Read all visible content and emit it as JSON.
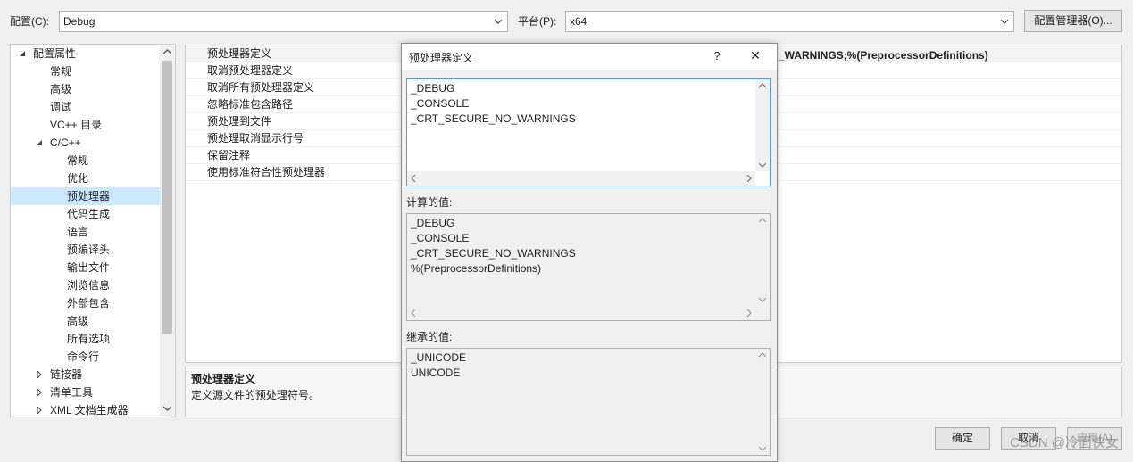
{
  "toolbar": {
    "config_label": "配置(C):",
    "config_value": "Debug",
    "platform_label": "平台(P):",
    "platform_value": "x64",
    "config_manager_button": "配置管理器(O)..."
  },
  "tree": {
    "items": [
      {
        "label": "配置属性",
        "expander": "expanded"
      },
      {
        "label": "常规"
      },
      {
        "label": "高级"
      },
      {
        "label": "调试"
      },
      {
        "label": "VC++ 目录"
      },
      {
        "label": "C/C++",
        "expander": "expanded"
      },
      {
        "label": "常规"
      },
      {
        "label": "优化"
      },
      {
        "label": "预处理器",
        "selected": true
      },
      {
        "label": "代码生成"
      },
      {
        "label": "语言"
      },
      {
        "label": "预编译头"
      },
      {
        "label": "输出文件"
      },
      {
        "label": "浏览信息"
      },
      {
        "label": "外部包含"
      },
      {
        "label": "高级"
      },
      {
        "label": "所有选项"
      },
      {
        "label": "命令行"
      },
      {
        "label": "链接器",
        "expander": "collapsed"
      },
      {
        "label": "清单工具",
        "expander": "collapsed"
      },
      {
        "label": "XML 文档生成器",
        "expander": "collapsed"
      }
    ]
  },
  "properties": {
    "rows": [
      "预处理器定义",
      "取消预处理器定义",
      "取消所有预处理器定义",
      "忽略标准包含路径",
      "预处理到文件",
      "预处理取消显示行号",
      "保留注释",
      "使用标准符合性预处理器"
    ],
    "first_value_visible": "_WARNINGS;%(PreprocessorDefinitions)"
  },
  "description": {
    "title": "预处理器定义",
    "text": "定义源文件的预处理符号。"
  },
  "buttons": {
    "ok": "确定",
    "cancel": "取消",
    "apply": "应用(A)"
  },
  "dialog": {
    "title": "预处理器定义",
    "help": "?",
    "close": "✕",
    "edit_lines": [
      "_DEBUG",
      "_CONSOLE",
      "_CRT_SECURE_NO_WARNINGS"
    ],
    "computed_label": "计算的值:",
    "computed_lines": [
      "_DEBUG",
      "_CONSOLE",
      "_CRT_SECURE_NO_WARNINGS",
      "%(PreprocessorDefinitions)"
    ],
    "inherited_label": "继承的值:",
    "inherited_lines": [
      "_UNICODE",
      "UNICODE"
    ]
  },
  "watermark": "CSDN @冷面侠女"
}
